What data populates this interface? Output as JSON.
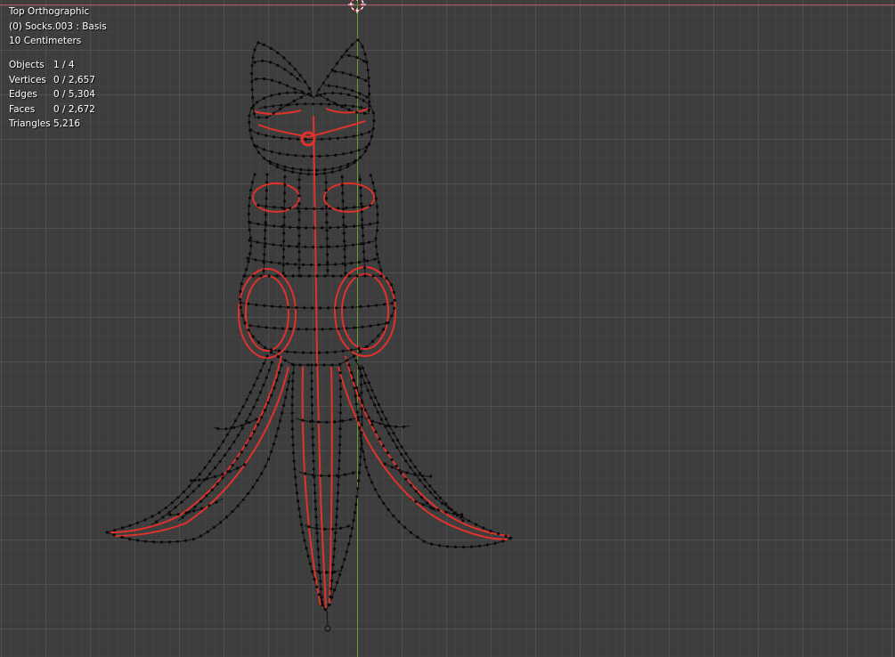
{
  "viewport": {
    "view_name": "Top Orthographic",
    "object_info": "(0) Socks.003 : Basis",
    "grid_scale": "10 Centimeters"
  },
  "stats": [
    {
      "label": "Objects",
      "value": "1 / 4"
    },
    {
      "label": "Vertices",
      "value": "0 / 2,657"
    },
    {
      "label": "Edges",
      "value": "0 / 5,304"
    },
    {
      "label": "Faces",
      "value": "0 / 2,672"
    },
    {
      "label": "Triangles",
      "value": "5,216"
    }
  ],
  "colors": {
    "background": "#3d3d3d",
    "x_axis": "#b3505c",
    "y_axis": "#6a9a2e",
    "wire": "#111111",
    "seam": "#e0312b"
  }
}
